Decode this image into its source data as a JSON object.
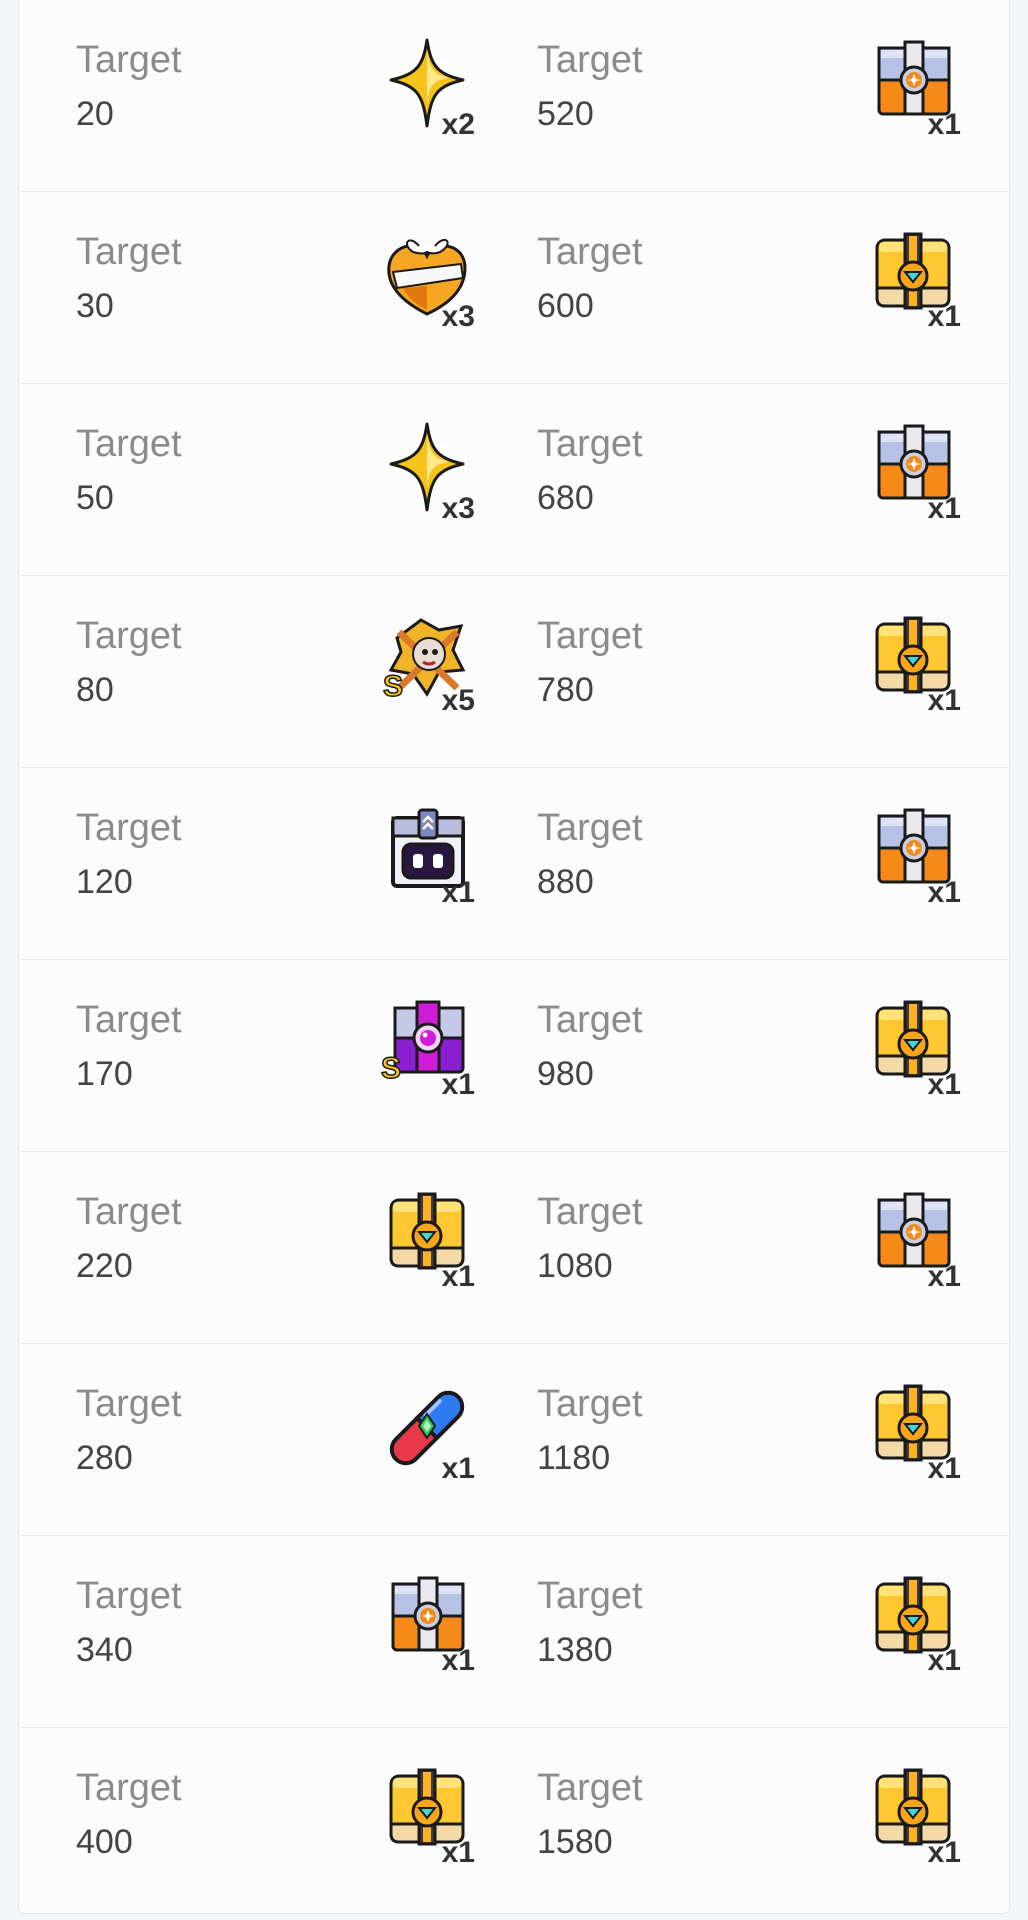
{
  "rewards": {
    "label": "Target",
    "rows": [
      {
        "left": {
          "target": "20",
          "icon": "star-icon",
          "qty": "x2"
        },
        "right": {
          "target": "520",
          "icon": "orange-chest-icon",
          "qty": "x1"
        }
      },
      {
        "left": {
          "target": "30",
          "icon": "heart-gift-icon",
          "qty": "x3"
        },
        "right": {
          "target": "600",
          "icon": "gold-chest-icon",
          "qty": "x1"
        }
      },
      {
        "left": {
          "target": "50",
          "icon": "star-icon",
          "qty": "x3"
        },
        "right": {
          "target": "680",
          "icon": "orange-chest-icon",
          "qty": "x1"
        }
      },
      {
        "left": {
          "target": "80",
          "icon": "s-rank-scroll-icon",
          "qty": "x5"
        },
        "right": {
          "target": "780",
          "icon": "gold-chest-icon",
          "qty": "x1"
        }
      },
      {
        "left": {
          "target": "120",
          "icon": "purple-robot-box-icon",
          "qty": "x1"
        },
        "right": {
          "target": "880",
          "icon": "orange-chest-icon",
          "qty": "x1"
        }
      },
      {
        "left": {
          "target": "170",
          "icon": "s-rank-purple-chest-icon",
          "qty": "x1"
        },
        "right": {
          "target": "980",
          "icon": "gold-chest-icon",
          "qty": "x1"
        }
      },
      {
        "left": {
          "target": "220",
          "icon": "gold-chest-icon",
          "qty": "x1"
        },
        "right": {
          "target": "1080",
          "icon": "orange-chest-icon",
          "qty": "x1"
        }
      },
      {
        "left": {
          "target": "280",
          "icon": "pill-capsule-icon",
          "qty": "x1"
        },
        "right": {
          "target": "1180",
          "icon": "gold-chest-icon",
          "qty": "x1"
        }
      },
      {
        "left": {
          "target": "340",
          "icon": "orange-chest-icon",
          "qty": "x1"
        },
        "right": {
          "target": "1380",
          "icon": "gold-chest-icon",
          "qty": "x1"
        }
      },
      {
        "left": {
          "target": "400",
          "icon": "gold-chest-icon",
          "qty": "x1"
        },
        "right": {
          "target": "1580",
          "icon": "gold-chest-icon",
          "qty": "x1"
        }
      }
    ]
  },
  "colors": {
    "background": "#f4f5f9",
    "card": "#fcfcfd",
    "divider": "#e6e8ee",
    "label": "#8b8b8b",
    "value": "#444444",
    "quantity": "#333333"
  }
}
